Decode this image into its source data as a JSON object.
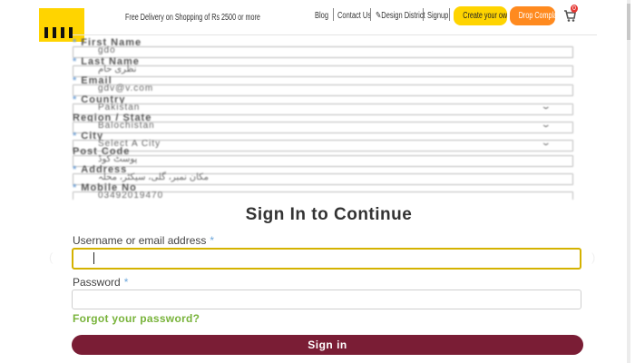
{
  "header": {
    "promo": "Free Delivery on Shopping of Rs 2500 or more",
    "nav": {
      "blog": "Blog",
      "contact": "Contact Us",
      "design_district": "Design District",
      "signup": "Signup"
    },
    "create_button": "Create your own",
    "complaint_button": "Drop Complaint",
    "cart_count": "0",
    "colors": {
      "logo": "#ffd400",
      "create": "#ffd400",
      "complaint": "#ff8a1f",
      "badge": "#e53935"
    }
  },
  "background_form": {
    "fields": [
      {
        "label": "First Name",
        "value": "gdo"
      },
      {
        "label": "Last Name",
        "value": "نظری حام"
      },
      {
        "label": "Email",
        "value": "gdv@v.com"
      },
      {
        "label": "Country",
        "value": "Pakistan"
      },
      {
        "label": "Region / State",
        "value": "Balochistan"
      },
      {
        "label": "City",
        "value": "Select A City"
      },
      {
        "label": "Post Code",
        "value": "پوسٹ کوڈ"
      },
      {
        "label": "Address",
        "value": "مکان نمبر، گلی، سیکٹر، محلہ"
      },
      {
        "label": "Mobile No",
        "value": "03492019470"
      }
    ]
  },
  "signin": {
    "title": "Sign In to Continue",
    "username_label": "Username or email address",
    "username_value": "",
    "password_label": "Password",
    "required_mark": "*",
    "forgot": "Forgot your password?",
    "submit": "Sign in",
    "colors": {
      "button": "#7a1d35",
      "forgot": "#78b33a",
      "focus": "#d4b200"
    }
  }
}
